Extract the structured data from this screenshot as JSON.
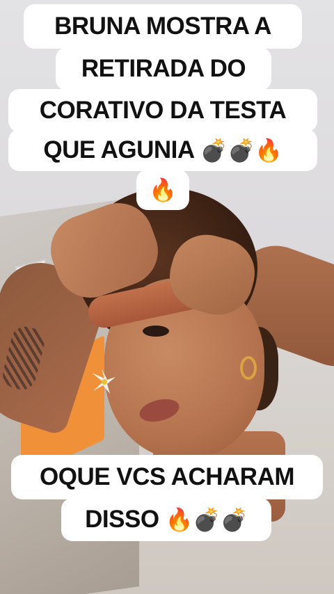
{
  "caption_top": {
    "line1": "BRUNA MOSTRA A",
    "line2": "RETIRADA DO",
    "line3": "CORATIVO DA TESTA",
    "line4_text": "QUE AGUNIA",
    "line4_emojis": "💣💣🔥",
    "line5_emojis": "🔥"
  },
  "caption_bottom": {
    "line1": "OQUE VCS ACHARAM",
    "line2_text": "DISSO",
    "line2_emojis": "🔥💣💣"
  }
}
